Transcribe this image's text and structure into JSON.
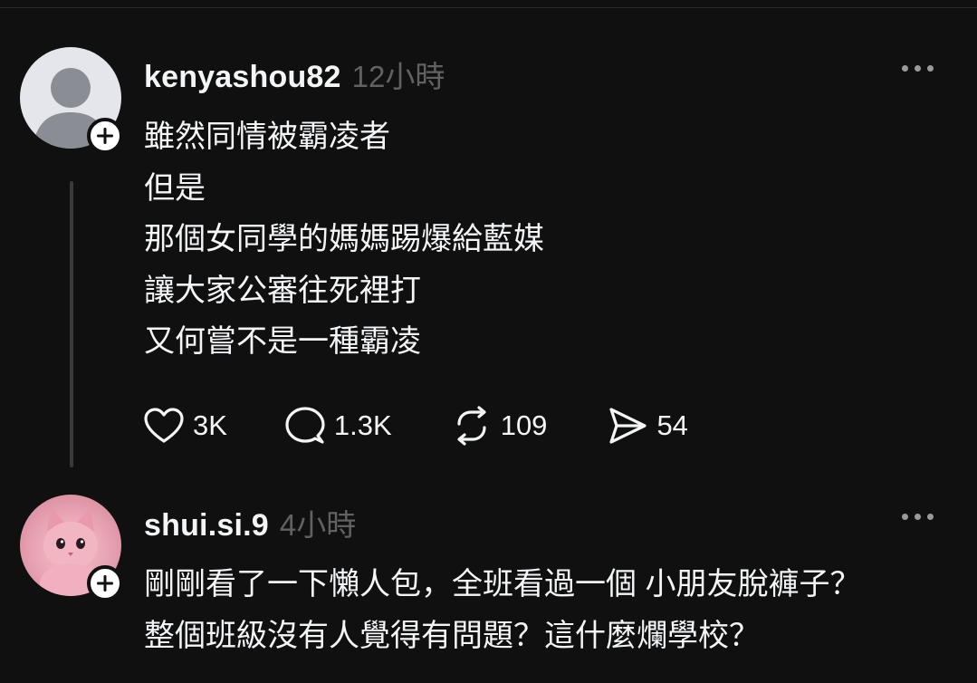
{
  "posts": [
    {
      "username": "kenyashou82",
      "time": "12小時",
      "avatar_icon": "default-user-icon",
      "body": "雖然同情被霸凌者\n但是\n那個女同學的媽媽踢爆給藍媒\n讓大家公審往死裡打\n又何嘗不是一種霸凌",
      "actions": {
        "likes": "3K",
        "comments": "1.3K",
        "reposts": "109",
        "shares": "54"
      }
    },
    {
      "username": "shui.si.9",
      "time": "4小時",
      "avatar_icon": "pink-kitten-avatar",
      "body": "剛剛看了一下懶人包，全班看過一個 小朋友脫褲子？\n整個班級沒有人覺得有問題？這什麼爛學校？"
    }
  ],
  "colors": {
    "background": "#101010",
    "text": "#f3f5f7",
    "muted": "#616161",
    "thread_line": "#3a3a3a"
  }
}
